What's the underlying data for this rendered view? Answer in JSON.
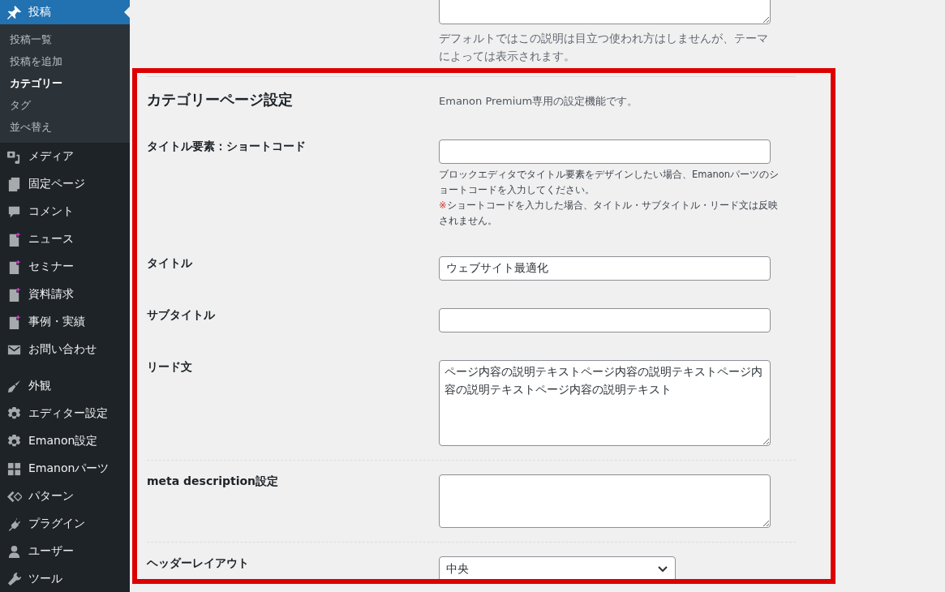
{
  "sidebar": {
    "groups": [
      {
        "items": [
          {
            "label": "投稿",
            "selected": true,
            "submenu": [
              {
                "label": "投稿一覧",
                "selected": false
              },
              {
                "label": "投稿を追加",
                "selected": false
              },
              {
                "label": "カテゴリー",
                "selected": true
              },
              {
                "label": "タグ",
                "selected": false
              },
              {
                "label": "並べ替え",
                "selected": false
              }
            ]
          },
          {
            "label": "メディア",
            "selected": false
          },
          {
            "label": "固定ページ",
            "selected": false
          },
          {
            "label": "コメント",
            "selected": false
          },
          {
            "label": "ニュース",
            "selected": false
          },
          {
            "label": "セミナー",
            "selected": false
          },
          {
            "label": "資料請求",
            "selected": false
          },
          {
            "label": "事例・実績",
            "selected": false
          },
          {
            "label": "お問い合わせ",
            "selected": false
          }
        ]
      },
      {
        "items": [
          {
            "label": "外観",
            "selected": false
          },
          {
            "label": "エディター設定",
            "selected": false
          },
          {
            "label": "Emanon設定",
            "selected": false
          },
          {
            "label": "Emanonパーツ",
            "selected": false
          },
          {
            "label": "パターン",
            "selected": false
          },
          {
            "label": "プラグイン",
            "selected": false
          },
          {
            "label": "ユーザー",
            "selected": false
          },
          {
            "label": "ツール",
            "selected": false
          }
        ]
      }
    ]
  },
  "description_field": {
    "help": "デフォルトではこの説明は目立つ使われ方はしませんが、テーマによっては表示されます。"
  },
  "category_page_settings": {
    "title": "カテゴリーページ設定",
    "note": "Emanon Premium専用の設定機能です。",
    "rows": [
      {
        "label": "タイトル要素：ショートコード",
        "kind": "input",
        "value": "",
        "help": "ブロックエディタでタイトル要素をデザインしたい場合、Emanonパーツのショートコードを入力してください。",
        "warning": {
          "mark": "※",
          "text": "ショートコードを入力した場合、タイトル・サブタイトル・リード文は反映されません。"
        }
      },
      {
        "label": "タイトル",
        "kind": "input",
        "value": "ウェブサイト最適化"
      },
      {
        "label": "サブタイトル",
        "kind": "input",
        "value": ""
      },
      {
        "label": "リード文",
        "kind": "textarea",
        "value": "ページ内容の説明テキストページ内容の説明テキストページ内容の説明テキストページ内容の説明テキスト"
      },
      {
        "kind": "divider"
      },
      {
        "label": "meta description設定",
        "kind": "textarea",
        "value": ""
      },
      {
        "kind": "divider"
      },
      {
        "label": "ヘッダーレイアウト",
        "kind": "select",
        "value": "中央"
      }
    ]
  }
}
